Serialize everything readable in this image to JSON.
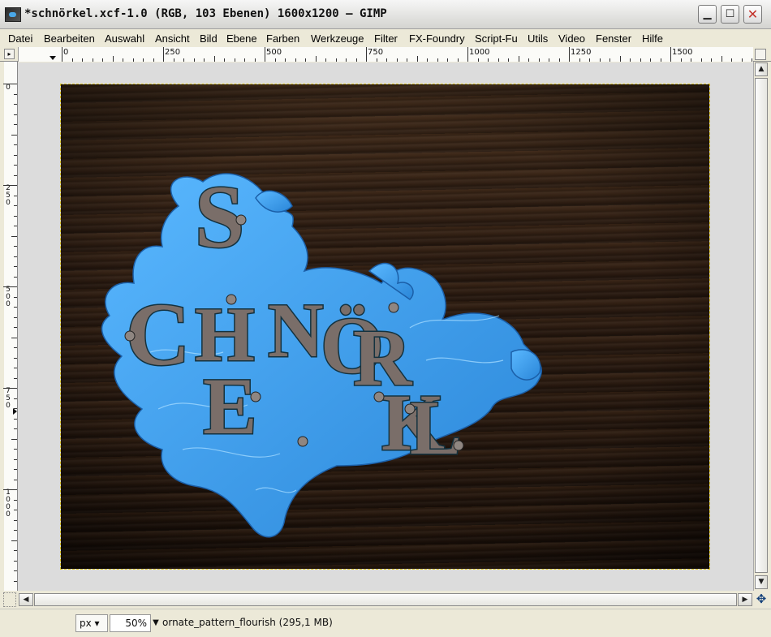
{
  "window": {
    "title": "*schnörkel.xcf-1.0 (RGB, 103 Ebenen) 1600x1200 – GIMP",
    "controls": {
      "minimize_icon": "minimize-icon",
      "maximize_icon": "maximize-icon",
      "close_icon": "close-icon"
    }
  },
  "menu": [
    "Datei",
    "Bearbeiten",
    "Auswahl",
    "Ansicht",
    "Bild",
    "Ebene",
    "Farben",
    "Werkzeuge",
    "Filter",
    "FX-Foundry",
    "Script-Fu",
    "Utils",
    "Video",
    "Fenster",
    "Hilfe"
  ],
  "ruler": {
    "horizontal_labels": [
      "0",
      "250",
      "500",
      "750",
      "1000",
      "1250",
      "1500"
    ],
    "vertical_labels": [
      "0",
      "250",
      "500",
      "750",
      "1000"
    ]
  },
  "canvas": {
    "image_colors": {
      "wood": "#2a1a10",
      "splash": "#3fa0ee",
      "letters": "#7a6e69",
      "outline": "#1a8fb0"
    },
    "artwork_text": "Schnörkel"
  },
  "status": {
    "unit": "px",
    "zoom": "50%",
    "info": "ornate_pattern_flourish (295,1 MB)"
  }
}
